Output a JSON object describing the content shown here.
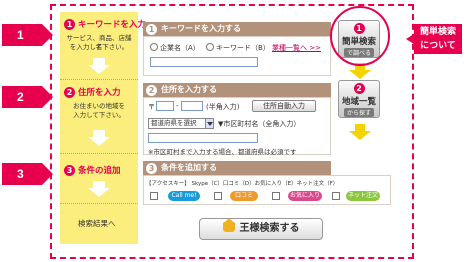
{
  "steps": [
    "1",
    "2",
    "3"
  ],
  "left": {
    "step1": {
      "num": "1",
      "title": "キーワードを入力",
      "desc1": "サービス、商品、店舗名",
      "desc2": "を入力して下さい。"
    },
    "step2": {
      "num": "2",
      "title": "住所を入力",
      "desc1": "お住まいの地域を",
      "desc2": "入力して下さい。"
    },
    "step3": {
      "num": "3",
      "title": "条件の追加"
    },
    "results": "検索結果へ"
  },
  "keyword": {
    "num": "1",
    "title": "キーワードを入力する",
    "opt_company": "企業名（A）",
    "opt_keyword": "キーワード（B）",
    "list_link": "業種一覧へ >>"
  },
  "address": {
    "num": "2",
    "title": "住所を入力する",
    "postal_mark": "〒",
    "postal_hint": "(半角入力)",
    "auto_button": "住所自動入力",
    "prefecture_select": "都道府県を選択",
    "city_label": "▼市区町村名（全角入力）",
    "note": "※市区町村まで入力する場合、都道府県は必須です"
  },
  "conditions": {
    "num": "3",
    "title": "条件を追加する",
    "legend": "【アクセスキー】 Skype（C）口コミ（D）お気に入り（E）ネット注文（F）",
    "tags": [
      "Call me!",
      "口コミ",
      "お気に入り",
      "ネット注文"
    ]
  },
  "search_button": "王様検索する",
  "right_buttons": [
    {
      "num": "1",
      "title": "簡単検索",
      "sub": "で調べる"
    },
    {
      "num": "2",
      "title": "地域一覧",
      "sub": "から探す"
    }
  ],
  "callout": {
    "line1": "簡単検索",
    "line2": "について"
  },
  "colors": {
    "accent": "#e6004d",
    "yellow": "#fbee7d",
    "bar": "#b3927c",
    "arrow": "#f6d200"
  }
}
